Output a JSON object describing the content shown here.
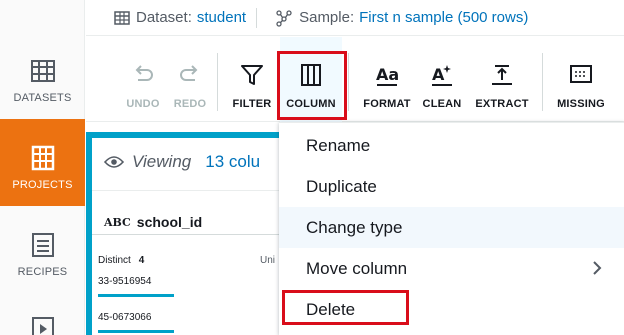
{
  "sidebar": {
    "items": [
      {
        "label": "DATASETS",
        "icon": "table-icon"
      },
      {
        "label": "PROJECTS",
        "icon": "grid-icon",
        "active": true
      },
      {
        "label": "RECIPES",
        "icon": "list-icon"
      }
    ]
  },
  "header": {
    "dataset_label": "Dataset:",
    "dataset_value": "student",
    "sample_label": "Sample:",
    "sample_value": "First n sample (500 rows)"
  },
  "toolbar": {
    "undo": "UNDO",
    "redo": "REDO",
    "filter": "FILTER",
    "column": "COLUMN",
    "format": "FORMAT",
    "clean": "CLEAN",
    "extract": "EXTRACT",
    "missing": "MISSING"
  },
  "grid": {
    "viewing_label": "Viewing",
    "count_text": "13 colu",
    "column_type": "ABC",
    "column_name": "school_id",
    "distinct_label": "Distinct",
    "distinct_value": "4",
    "unique_label": "Uni",
    "values": [
      "33-9516954",
      "45-0673066"
    ]
  },
  "menu": {
    "items": [
      {
        "label": "Rename"
      },
      {
        "label": "Duplicate"
      },
      {
        "label": "Change type"
      },
      {
        "label": "Move column",
        "submenu": true
      },
      {
        "label": "Delete"
      }
    ]
  },
  "colors": {
    "accent_orange": "#ec7211",
    "link_blue": "#0073bb",
    "highlight_red": "#d90d1a",
    "bar_cyan": "#00a1c9"
  }
}
